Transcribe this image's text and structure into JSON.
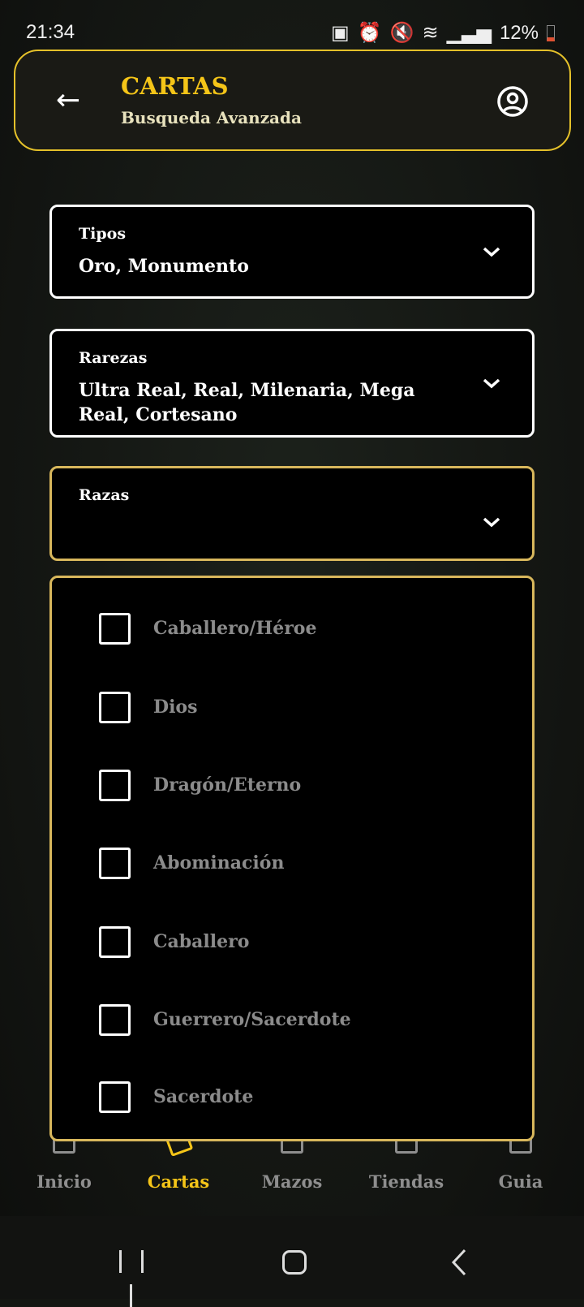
{
  "status_bar": {
    "time": "21:34",
    "battery": "12%"
  },
  "header": {
    "title": "CARTAS",
    "subtitle": "Busqueda Avanzada"
  },
  "filters": [
    {
      "label": "Tipos",
      "value": "Oro, Monumento"
    },
    {
      "label": "Rarezas",
      "value": "Ultra Real, Real, Milenaria, Mega Real, Cortesano"
    },
    {
      "label": "Razas",
      "value": ""
    }
  ],
  "razas_options": [
    {
      "label": "Caballero/Héroe",
      "checked": false
    },
    {
      "label": "Dios",
      "checked": false
    },
    {
      "label": "Dragón/Eterno",
      "checked": false
    },
    {
      "label": "Abominación",
      "checked": false
    },
    {
      "label": "Caballero",
      "checked": false
    },
    {
      "label": "Guerrero/Sacerdote",
      "checked": false
    },
    {
      "label": "Sacerdote",
      "checked": false
    }
  ],
  "bottom_nav": [
    {
      "label": "Inicio",
      "icon": "home-icon"
    },
    {
      "label": "Cartas",
      "icon": "cards-icon",
      "active": true
    },
    {
      "label": "Mazos",
      "icon": "deck-icon"
    },
    {
      "label": "Tiendas",
      "icon": "store-icon"
    },
    {
      "label": "Guia",
      "icon": "book-icon"
    }
  ],
  "colors": {
    "accent": "#f5c518",
    "border_gold": "#d8b75c",
    "background": "#141612"
  }
}
